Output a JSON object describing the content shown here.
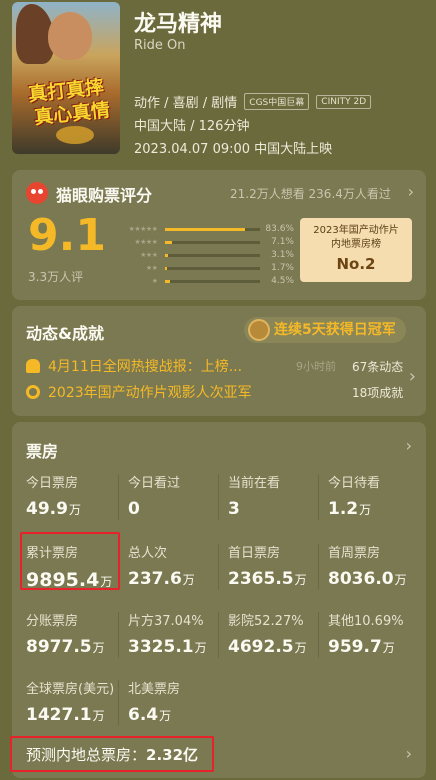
{
  "movie": {
    "title": "龙马精神",
    "subtitle": "Ride On",
    "poster_slogan1": "真打真摔",
    "poster_slogan2": "真心真情",
    "genres": "动作 / 喜剧 / 剧情",
    "badges": [
      "CGS中国巨幕",
      "CINITY 2D"
    ],
    "region_duration": "中国大陆 / 126分钟",
    "release": "2023.04.07 09:00 中国大陆上映"
  },
  "rating": {
    "title": "猫眼购票评分",
    "want_watch": "21.2万人想看 236.4万人看过",
    "score": "9.1",
    "raters": "3.3万人评",
    "distribution": [
      {
        "stars": 5,
        "pct_text": "83.6%",
        "pct": 83.6
      },
      {
        "stars": 4,
        "pct_text": "7.1%",
        "pct": 7.1
      },
      {
        "stars": 3,
        "pct_text": "3.1%",
        "pct": 3.1
      },
      {
        "stars": 2,
        "pct_text": "1.7%",
        "pct": 1.7
      },
      {
        "stars": 1,
        "pct_text": "4.5%",
        "pct": 4.5
      }
    ],
    "rank_line1": "2023年国产动作片",
    "rank_line2": "内地票房榜",
    "rank_value": "No.2"
  },
  "activity": {
    "title": "动态&成就",
    "champion": "连续5天获得日冠军",
    "item1": "4月11日全网热搜战报：上榜...",
    "item1_time": "9小时前",
    "item1_count": "67条动态",
    "item2": "2023年国产动作片观影人次亚军",
    "item2_count": "18项成就"
  },
  "boxoffice": {
    "title": "票房",
    "cells": [
      {
        "label": "今日票房",
        "num": "49.9",
        "unit": "万"
      },
      {
        "label": "今日看过",
        "num": "0",
        "unit": ""
      },
      {
        "label": "当前在看",
        "num": "3",
        "unit": ""
      },
      {
        "label": "今日待看",
        "num": "1.2",
        "unit": "万"
      },
      {
        "label": "累计票房",
        "num": "9895.4",
        "unit": "万"
      },
      {
        "label": "总人次",
        "num": "237.6",
        "unit": "万"
      },
      {
        "label": "首日票房",
        "num": "2365.5",
        "unit": "万"
      },
      {
        "label": "首周票房",
        "num": "8036.0",
        "unit": "万"
      },
      {
        "label": "分账票房",
        "num": "8977.5",
        "unit": "万"
      },
      {
        "label": "片方37.04%",
        "num": "3325.1",
        "unit": "万"
      },
      {
        "label": "影院52.27%",
        "num": "4692.5",
        "unit": "万"
      },
      {
        "label": "其他10.69%",
        "num": "959.7",
        "unit": "万"
      },
      {
        "label": "全球票房(美元)",
        "num": "1427.1",
        "unit": "万"
      },
      {
        "label": "北美票房",
        "num": "6.4",
        "unit": "万"
      }
    ],
    "forecast_label": "预测内地总票房：",
    "forecast_value": "2.32亿"
  },
  "colors": {
    "accent": "#f5b927",
    "background": "#6b6a3c",
    "card": "#7a7951",
    "highlight_box": "#e8222a"
  }
}
